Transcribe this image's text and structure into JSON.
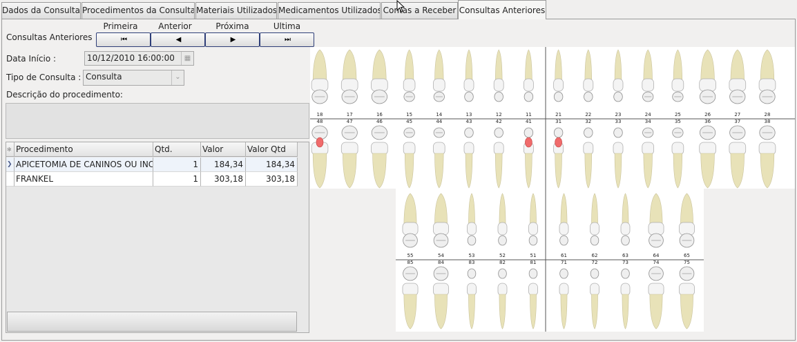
{
  "tabs": [
    {
      "label": "Dados da Consulta"
    },
    {
      "label": "Procedimentos da Consulta"
    },
    {
      "label": "Materiais Utilizados"
    },
    {
      "label": "Medicamentos Utilizados"
    },
    {
      "label": "Contas a Receber"
    },
    {
      "label": "Consultas Anteriores"
    }
  ],
  "nav": {
    "label": "Consultas Anteriores",
    "first_label": "Primeira",
    "prev_label": "Anterior",
    "next_label": "Próxima",
    "last_label": "Ultima"
  },
  "form": {
    "data_inicio_label": "Data Início :",
    "data_inicio_value": "10/12/2010 16:00:00",
    "tipo_label": "Tipo de Consulta :",
    "tipo_value": "Consulta",
    "descricao_label": "Descrição do procedimento:"
  },
  "grid": {
    "columns": [
      "Procedimento",
      "Qtd.",
      "Valor",
      "Valor Qtd"
    ],
    "rows": [
      {
        "procedimento": "APICETOMIA DE CANINOS OU INCI",
        "qtd": "1",
        "valor": "184,34",
        "valor_qtd": "184,34"
      },
      {
        "procedimento": "FRANKEL",
        "qtd": "1",
        "valor": "303,18",
        "valor_qtd": "303,18"
      }
    ]
  },
  "odontogram": {
    "permanent_upper": [
      "18",
      "17",
      "16",
      "15",
      "14",
      "13",
      "12",
      "11",
      "21",
      "22",
      "23",
      "24",
      "25",
      "26",
      "27",
      "28"
    ],
    "permanent_lower": [
      "48",
      "47",
      "46",
      "45",
      "44",
      "43",
      "42",
      "41",
      "31",
      "32",
      "33",
      "34",
      "35",
      "36",
      "37",
      "38"
    ],
    "deciduous_upper": [
      "55",
      "54",
      "53",
      "52",
      "51",
      "61",
      "62",
      "63",
      "64",
      "65"
    ],
    "deciduous_lower": [
      "85",
      "84",
      "83",
      "82",
      "81",
      "71",
      "72",
      "73",
      "74",
      "75"
    ],
    "marked_teeth": [
      "48",
      "41",
      "31"
    ],
    "mark_color": "#f06b6b",
    "crown_color": "#e8e2b8"
  }
}
